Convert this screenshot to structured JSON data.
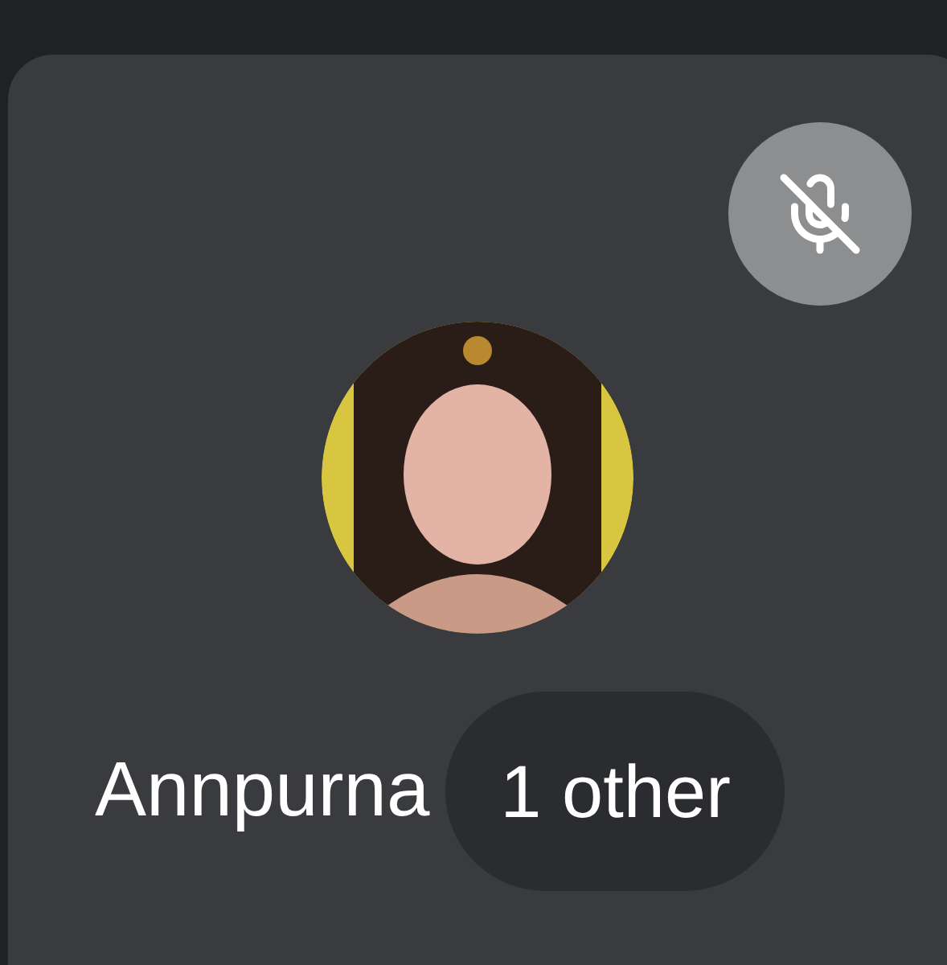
{
  "participant": {
    "name": "Annpurna",
    "muted": true
  },
  "overflow": {
    "label": "1 other"
  }
}
